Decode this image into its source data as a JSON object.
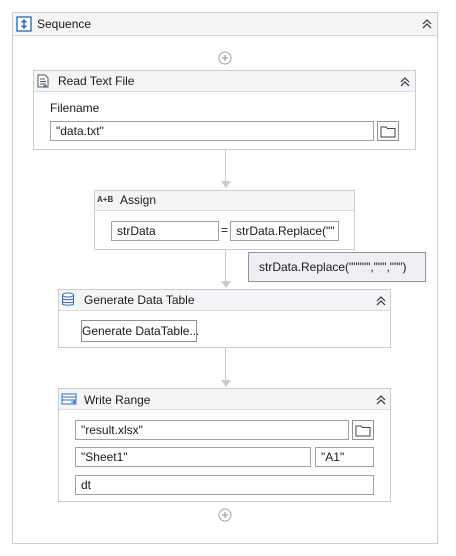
{
  "sequence": {
    "title": "Sequence"
  },
  "read_text_file": {
    "title": "Read Text File",
    "filename_label": "Filename",
    "filename_value": "\"data.txt\""
  },
  "assign": {
    "title": "Assign",
    "to_value": "strData",
    "equals": "=",
    "value_value": "strData.Replace(\"\"",
    "tooltip": "strData.Replace(\"\"\"\"\",\"\"\",\"\"\")"
  },
  "generate_data_table": {
    "title": "Generate Data Table",
    "button_label": "Generate DataTable..."
  },
  "write_range": {
    "title": "Write Range",
    "workbook_value": "\"result.xlsx\"",
    "sheet_value": "\"Sheet1\"",
    "cell_value": "\"A1\"",
    "datatable_value": "dt"
  },
  "icons": {
    "sequence": "sequence-icon",
    "read_text_file": "read-text-file-icon",
    "assign": "assign-icon",
    "generate_data_table": "database-icon",
    "write_range": "write-range-icon",
    "collapse": "chevron-double-up-icon",
    "folder": "folder-icon",
    "add": "add-activity-icon"
  },
  "colors": {
    "accent": "#2f6fba"
  }
}
